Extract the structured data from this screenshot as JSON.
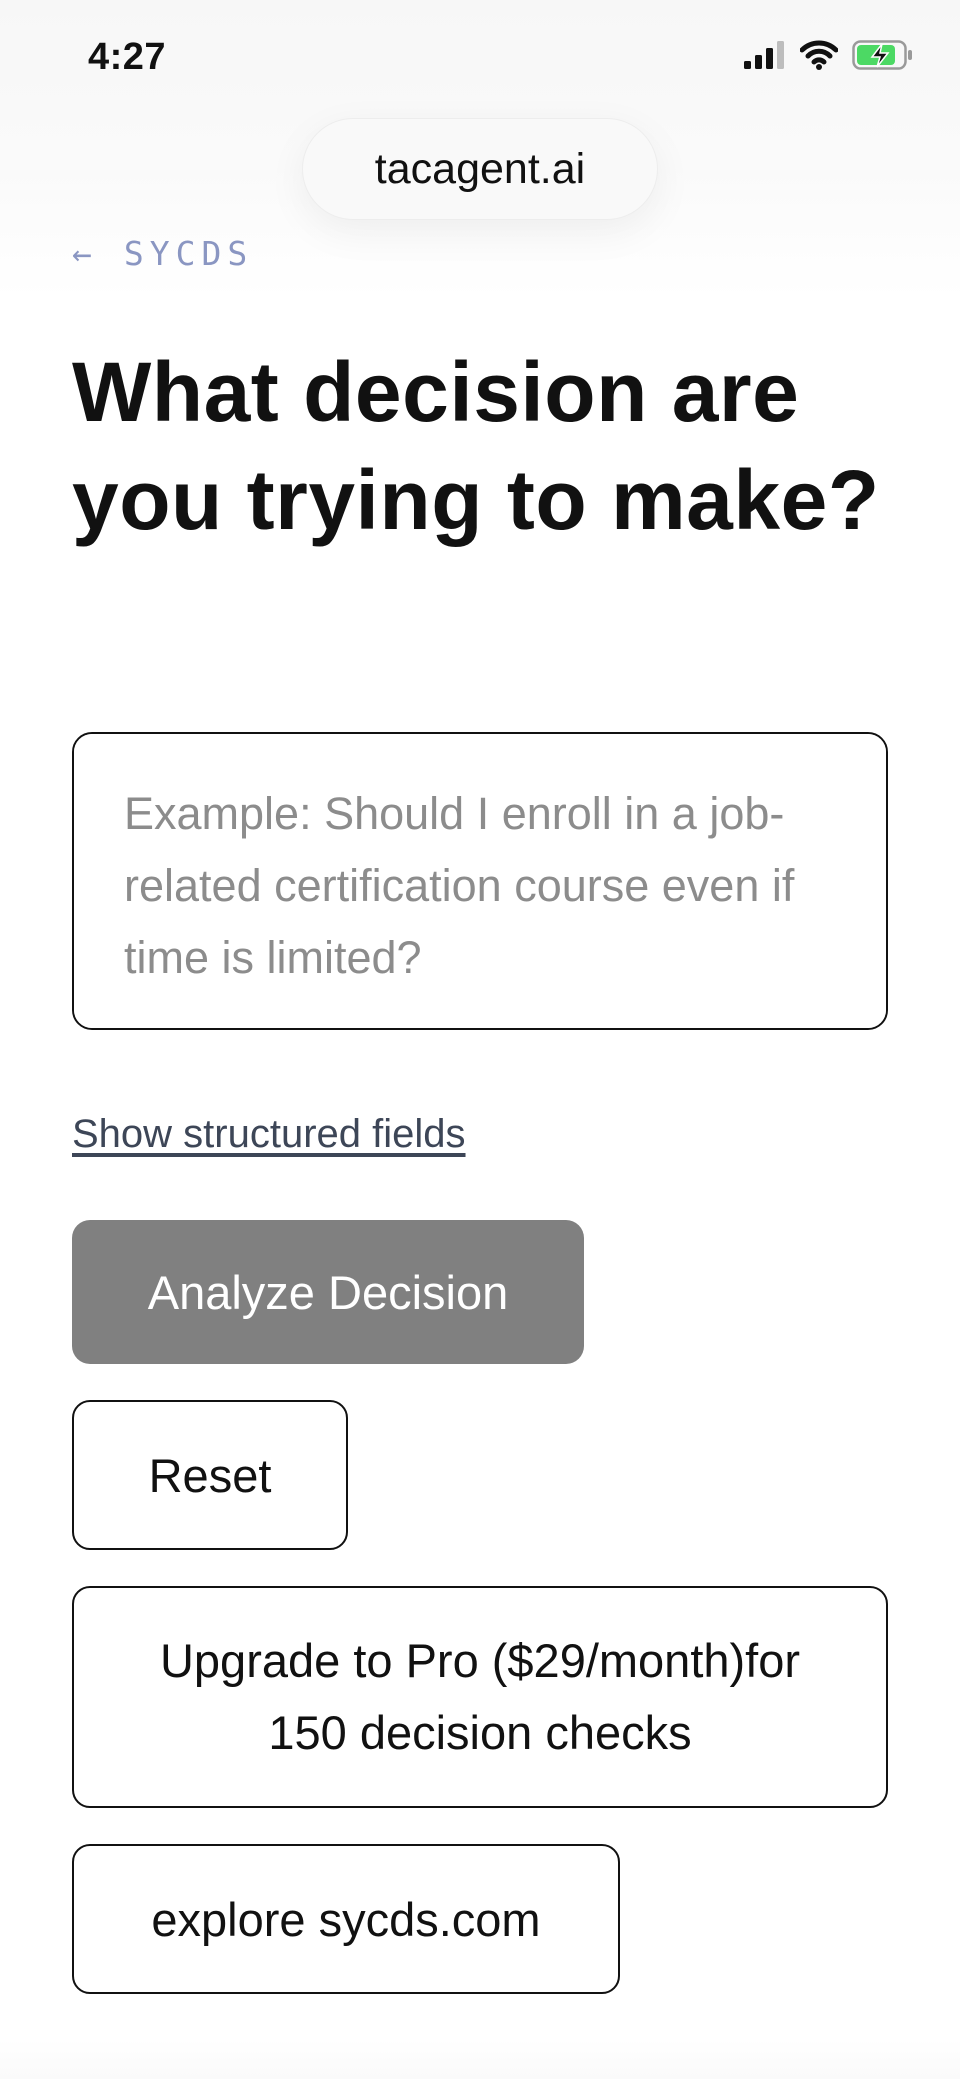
{
  "status_bar": {
    "time": "4:27",
    "icons": [
      "signal-icon",
      "wifi-icon",
      "battery-charging-icon"
    ],
    "battery_color": "#4cd964"
  },
  "browser": {
    "url": "tacagent.ai"
  },
  "nav": {
    "back_arrow": "←",
    "back_label": "SYCDS"
  },
  "main": {
    "title": "What decision are you trying to make?",
    "decision_input": {
      "value": "",
      "placeholder": "Example: Should I enroll in a job-related certification course even if time is limited?"
    },
    "structured_fields_link": "Show structured fields",
    "analyze_button": "Analyze Decision",
    "reset_button": "Reset",
    "upgrade_button": "Upgrade to Pro ($29/month)for 150 decision checks",
    "explore_button": "explore sycds.com"
  },
  "colors": {
    "text": "#111111",
    "muted_link": "#8a96c2",
    "secondary_link": "#3d4657",
    "primary_button_bg": "#808080",
    "placeholder": "#8c8c8c"
  }
}
